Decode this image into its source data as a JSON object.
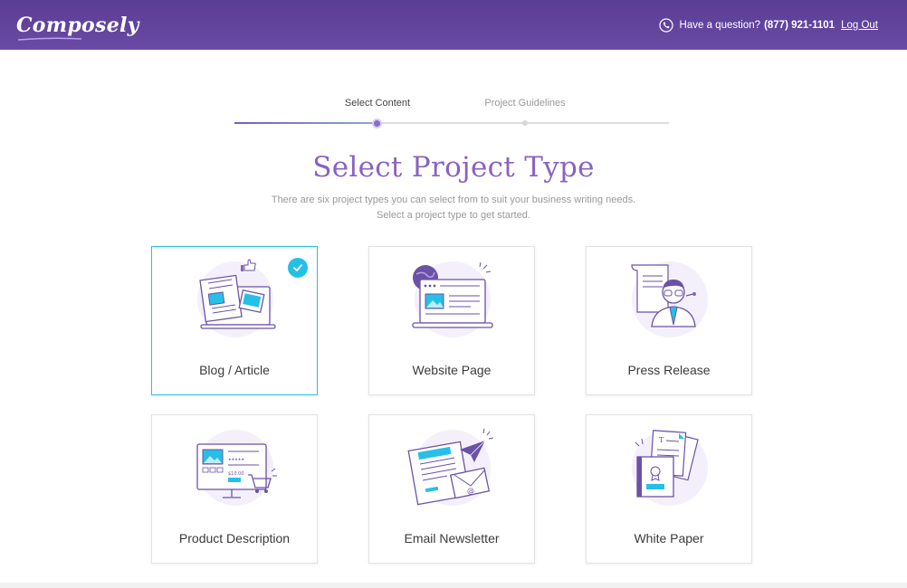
{
  "header": {
    "logo": "Composely",
    "question": "Have a question?",
    "phone": "(877) 921-1101",
    "logout": "Log Out"
  },
  "stepper": {
    "steps": [
      {
        "label": "Select Content",
        "state": "active"
      },
      {
        "label": "Project Guidelines",
        "state": "inactive"
      }
    ]
  },
  "main": {
    "title": "Select Project Type",
    "subtitle_line1": "There are six project types you can select from to suit your business writing needs.",
    "subtitle_line2": "Select a project type to get started."
  },
  "project_types": [
    {
      "label": "Blog / Article",
      "icon": "blog-article-illustration",
      "selected": true
    },
    {
      "label": "Website Page",
      "icon": "website-page-illustration",
      "selected": false
    },
    {
      "label": "Press Release",
      "icon": "press-release-illustration",
      "selected": false
    },
    {
      "label": "Product Description",
      "icon": "product-description-illustration",
      "selected": false,
      "price_tag": "$10.00"
    },
    {
      "label": "Email Newsletter",
      "icon": "email-newsletter-illustration",
      "selected": false
    },
    {
      "label": "White Paper",
      "icon": "white-paper-illustration",
      "selected": false
    }
  ],
  "colors": {
    "header_bg": "#5a3d95",
    "accent_purple": "#8a62c1",
    "accent_cyan": "#25c0e8",
    "illustration_stroke": "#6b52a6",
    "illustration_bg": "#f4f0fb"
  }
}
